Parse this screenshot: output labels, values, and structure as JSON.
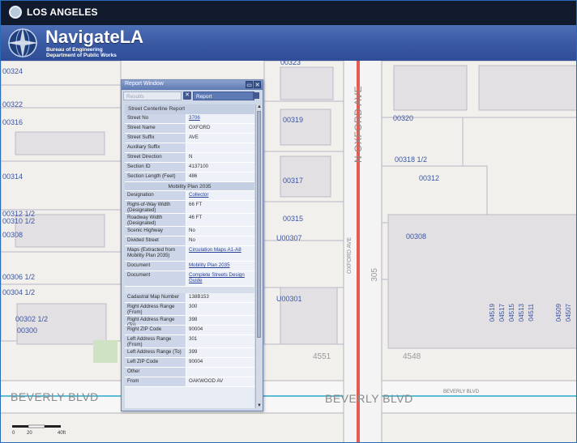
{
  "header": {
    "city_name": "LOS ANGELES"
  },
  "banner": {
    "app_title": "NavigateLA",
    "bureau_line1": "Bureau of Engineering",
    "bureau_line2": "Department of Public Works"
  },
  "map": {
    "addresses": {
      "a1": "00324",
      "a2": "00322",
      "a3": "00316",
      "a4": "00314",
      "a5": "00312 1/2",
      "a6": "00310 1/2",
      "a7": "00308",
      "a8": "00306 1/2",
      "a9": "00304 1/2",
      "a10": "00302 1/2",
      "a11": "00300",
      "b_top": "00323",
      "b1": "00319",
      "b2": "00317",
      "b3": "00315",
      "b4": "U00307",
      "b5": "U00301",
      "c1": "00320",
      "c2": "00318 1/2",
      "c3": "00312",
      "c4": "00308"
    },
    "vertical_numbers": [
      "04519",
      "04517",
      "04515",
      "04513",
      "04511",
      "04509",
      "04507"
    ],
    "street_oxford": "N OXFORD AVE",
    "street_beverly_left": "BEVERLY BLVD",
    "street_beverly_right": "BEVERLY BLVD",
    "street_beverly_small": "BEVERLY BLVD",
    "oxford_small": "OXFORD AVE",
    "lot_305": "305",
    "lot_4551": "4551",
    "lot_4548": "4548",
    "scale_labels": [
      "0",
      "20",
      "40ft"
    ]
  },
  "report_window": {
    "title": "Report Window",
    "tab_results": "Results",
    "tab_report": "Report",
    "header": "Street Centerline Report",
    "rows_a": [
      {
        "label": "Street No",
        "value": "3706",
        "link": true
      },
      {
        "label": "Street Name",
        "value": "OXFORD"
      },
      {
        "label": "Street Suffix",
        "value": "AVE"
      },
      {
        "label": "Auxiliary Suffix",
        "value": ""
      },
      {
        "label": "Street Direction",
        "value": "N"
      },
      {
        "label": "Section ID",
        "value": "4137100"
      },
      {
        "label": "Section Length (Feet)",
        "value": "486"
      }
    ],
    "section_title": "Mobility Plan 2035",
    "rows_b": [
      {
        "label": "Designation",
        "value": "Collector",
        "link": true
      },
      {
        "label": "Right-of-Way Width (Designated)",
        "value": "66 FT"
      },
      {
        "label": "Roadway Width (Designated)",
        "value": "46 FT"
      },
      {
        "label": "Scenic Highway",
        "value": "No"
      },
      {
        "label": "Divided Street",
        "value": "No"
      },
      {
        "label": "Maps (Extracted from Mobility Plan 2035)",
        "value": "Circulation Maps A1-A8",
        "link": true
      },
      {
        "label": "Document",
        "value": "Mobility Plan 2035",
        "link": true
      },
      {
        "label": "Document",
        "value": "Complete Streets Design Guide",
        "link": true
      }
    ],
    "rows_c": [
      {
        "label": "Cadastral Map Number",
        "value": "138B153"
      },
      {
        "label": "Right Address Range (From)",
        "value": "300"
      },
      {
        "label": "Right Address Range (To)",
        "value": "398"
      },
      {
        "label": "Right ZIP Code",
        "value": "90004"
      },
      {
        "label": "Left Address Range (From)",
        "value": "301"
      },
      {
        "label": "Left Address Range (To)",
        "value": "399"
      },
      {
        "label": "Left ZIP Code",
        "value": "90004"
      },
      {
        "label": "Other",
        "value": ""
      },
      {
        "label": "From",
        "value": "OAKWOOD AV"
      }
    ]
  }
}
